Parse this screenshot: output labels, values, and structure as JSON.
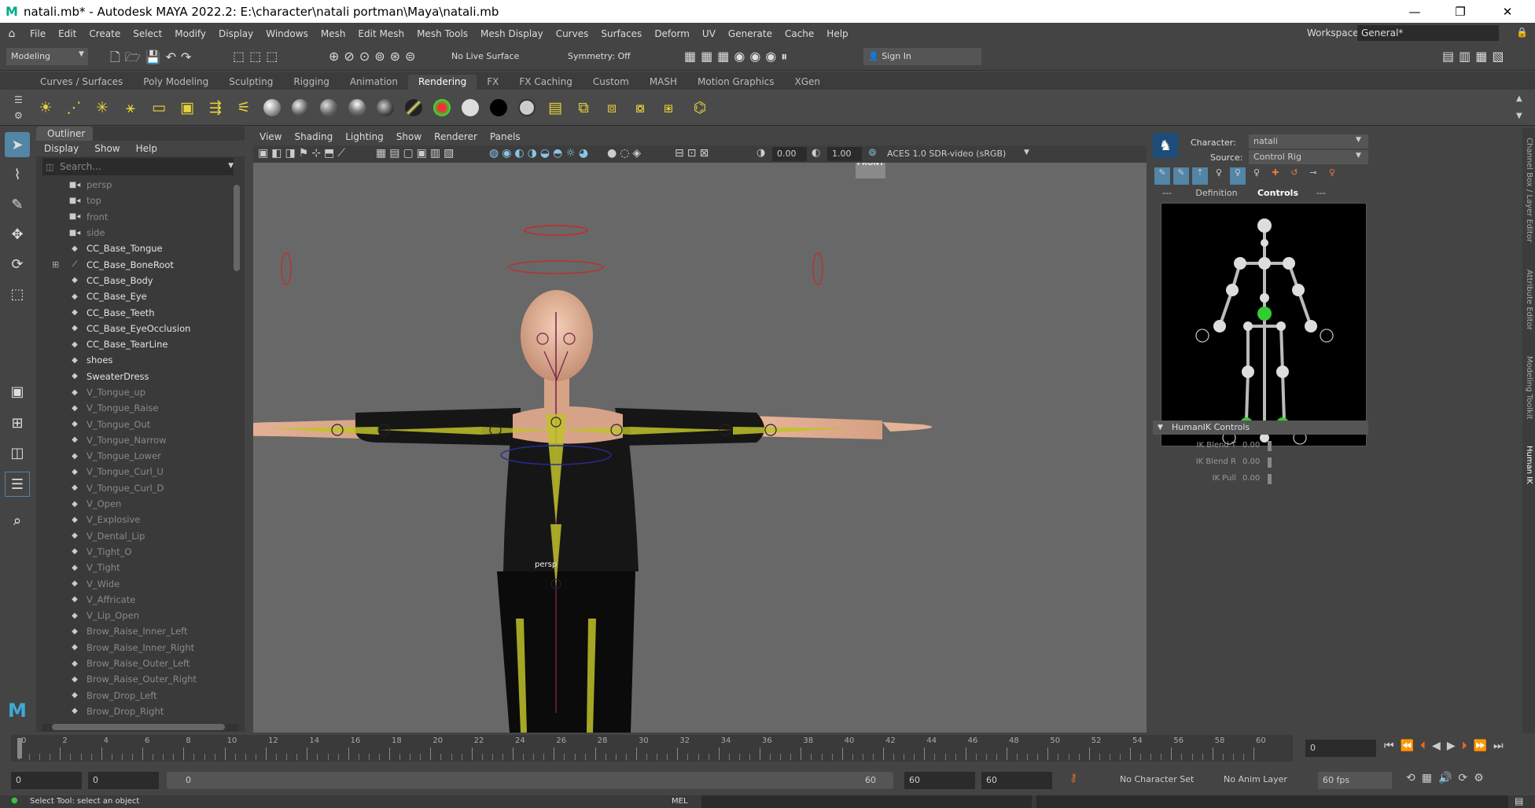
{
  "window": {
    "title": "natali.mb* - Autodesk MAYA 2022.2: E:\\character\\natali portman\\Maya\\natali.mb",
    "minimize_glyph": "—",
    "restore_glyph": "❐",
    "close_glyph": "✕"
  },
  "menubar": {
    "items": [
      "File",
      "Edit",
      "Create",
      "Select",
      "Modify",
      "Display",
      "Windows",
      "Mesh",
      "Edit Mesh",
      "Mesh Tools",
      "Mesh Display",
      "Curves",
      "Surfaces",
      "Deform",
      "UV",
      "Generate",
      "Cache",
      "Help"
    ],
    "workspace_label": "Workspace:",
    "workspace_value": "General*"
  },
  "statusline": {
    "mode": "Modeling",
    "live_surface": "No Live Surface",
    "symmetry": "Symmetry: Off",
    "sign_in": "Sign In"
  },
  "shelf": {
    "tabs": [
      "Curves / Surfaces",
      "Poly Modeling",
      "Sculpting",
      "Rigging",
      "Animation",
      "Rendering",
      "FX",
      "FX Caching",
      "Custom",
      "MASH",
      "Motion Graphics",
      "XGen"
    ],
    "active_tab": "Rendering"
  },
  "outliner": {
    "title": "Outliner",
    "menus": [
      "Display",
      "Show",
      "Help"
    ],
    "search_placeholder": "Search...",
    "items": [
      {
        "label": "persp",
        "style": "dim",
        "icon": "camera-icon"
      },
      {
        "label": "top",
        "style": "dim",
        "icon": "camera-icon"
      },
      {
        "label": "front",
        "style": "dim",
        "icon": "camera-icon"
      },
      {
        "label": "side",
        "style": "dim",
        "icon": "camera-icon"
      },
      {
        "label": "CC_Base_Tongue",
        "style": "light",
        "icon": "mesh-icon"
      },
      {
        "label": "CC_Base_BoneRoot",
        "style": "light",
        "icon": "joint-icon",
        "expander": "⊞"
      },
      {
        "label": "CC_Base_Body",
        "style": "light",
        "icon": "mesh-icon"
      },
      {
        "label": "CC_Base_Eye",
        "style": "light",
        "icon": "mesh-icon"
      },
      {
        "label": "CC_Base_Teeth",
        "style": "light",
        "icon": "mesh-icon"
      },
      {
        "label": "CC_Base_EyeOcclusion",
        "style": "light",
        "icon": "mesh-icon"
      },
      {
        "label": "CC_Base_TearLine",
        "style": "light",
        "icon": "mesh-icon"
      },
      {
        "label": "shoes",
        "style": "light",
        "icon": "mesh-icon"
      },
      {
        "label": "SweaterDress",
        "style": "light",
        "icon": "mesh-icon"
      },
      {
        "label": "V_Tongue_up",
        "style": "dim",
        "icon": "mesh-icon"
      },
      {
        "label": "V_Tongue_Raise",
        "style": "dim",
        "icon": "mesh-icon"
      },
      {
        "label": "V_Tongue_Out",
        "style": "dim",
        "icon": "mesh-icon"
      },
      {
        "label": "V_Tongue_Narrow",
        "style": "dim",
        "icon": "mesh-icon"
      },
      {
        "label": "V_Tongue_Lower",
        "style": "dim",
        "icon": "mesh-icon"
      },
      {
        "label": "V_Tongue_Curl_U",
        "style": "dim",
        "icon": "mesh-icon"
      },
      {
        "label": "V_Tongue_Curl_D",
        "style": "dim",
        "icon": "mesh-icon"
      },
      {
        "label": "V_Open",
        "style": "dim",
        "icon": "mesh-icon"
      },
      {
        "label": "V_Explosive",
        "style": "dim",
        "icon": "mesh-icon"
      },
      {
        "label": "V_Dental_Lip",
        "style": "dim",
        "icon": "mesh-icon"
      },
      {
        "label": "V_Tight_O",
        "style": "dim",
        "icon": "mesh-icon"
      },
      {
        "label": "V_Tight",
        "style": "dim",
        "icon": "mesh-icon"
      },
      {
        "label": "V_Wide",
        "style": "dim",
        "icon": "mesh-icon"
      },
      {
        "label": "V_Affricate",
        "style": "dim",
        "icon": "mesh-icon"
      },
      {
        "label": "V_Lip_Open",
        "style": "dim",
        "icon": "mesh-icon"
      },
      {
        "label": "Brow_Raise_Inner_Left",
        "style": "dim",
        "icon": "mesh-icon"
      },
      {
        "label": "Brow_Raise_Inner_Right",
        "style": "dim",
        "icon": "mesh-icon"
      },
      {
        "label": "Brow_Raise_Outer_Left",
        "style": "dim",
        "icon": "mesh-icon"
      },
      {
        "label": "Brow_Raise_Outer_Right",
        "style": "dim",
        "icon": "mesh-icon"
      },
      {
        "label": "Brow_Drop_Left",
        "style": "dim",
        "icon": "mesh-icon"
      },
      {
        "label": "Brow_Drop_Right",
        "style": "dim",
        "icon": "mesh-icon"
      }
    ]
  },
  "viewport": {
    "menus": [
      "View",
      "Shading",
      "Lighting",
      "Show",
      "Renderer",
      "Panels"
    ],
    "exposure": "0.00",
    "gamma": "1.00",
    "colorspace": "ACES 1.0 SDR-video (sRGB)",
    "camera_label": "persp",
    "viewcube_label": "FRONT"
  },
  "humanik": {
    "character_label": "Character:",
    "character_value": "natali",
    "source_label": "Source:",
    "source_value": "Control Rig",
    "tabs": [
      "---",
      "Definition",
      "Controls",
      "---"
    ],
    "active_tab": "Controls",
    "section_title": "HumanIK Controls",
    "sliders": [
      {
        "label": "IK Blend T",
        "value": "0.00"
      },
      {
        "label": "IK Blend R",
        "value": "0.00"
      },
      {
        "label": "IK Pull",
        "value": "0.00"
      }
    ]
  },
  "side_tabs": [
    "Channel Box / Layer Editor",
    "Attribute Editor",
    "Modeling Toolkit",
    "Human IK"
  ],
  "timeline": {
    "ticks": [
      "0",
      "2",
      "4",
      "6",
      "8",
      "10",
      "12",
      "14",
      "16",
      "18",
      "20",
      "22",
      "24",
      "26",
      "28",
      "30",
      "32",
      "34",
      "36",
      "38",
      "40",
      "42",
      "44",
      "46",
      "48",
      "50",
      "52",
      "54",
      "56",
      "58",
      "60"
    ],
    "current_frame": "0",
    "range_start": "0",
    "range_inner_start": "0",
    "range_slider_start": "0",
    "range_slider_end": "60",
    "range_inner_end": "60",
    "range_end": "60",
    "character_set": "No Character Set",
    "anim_layer": "No Anim Layer",
    "fps": "60 fps"
  },
  "helpline": {
    "text": "Select Tool: select an object",
    "script_lang": "MEL"
  },
  "colors": {
    "accent": "#5285a6",
    "selected_joint": "#33cc33",
    "joint_yellow": "#d4d41a",
    "control_red": "#c82828"
  }
}
